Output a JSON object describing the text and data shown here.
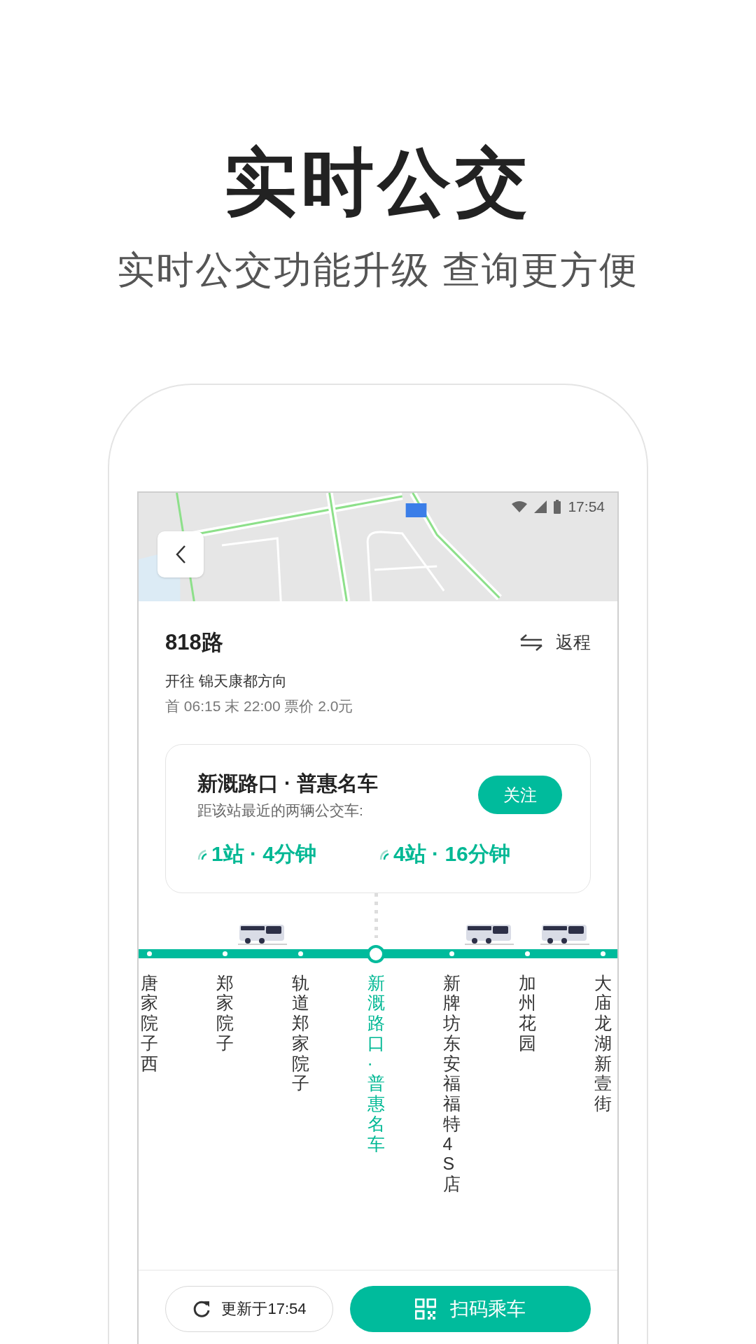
{
  "headline": "实时公交",
  "subheadline": "实时公交功能升级 查询更方便",
  "status_bar": {
    "time": "17:54"
  },
  "route": {
    "name": "818路",
    "return_label": "返程",
    "direction": "开往 锦天康都方向",
    "schedule": "首 06:15 末 22:00 票价 2.0元"
  },
  "stop_card": {
    "name": "新溉路口 · 普惠名车",
    "subtitle": "距该站最近的两辆公交车:",
    "follow_button": "关注",
    "arrivals": [
      {
        "text": "1站 · 4分钟"
      },
      {
        "text": "4站 · 16分钟"
      }
    ]
  },
  "stations": [
    {
      "name": "唐家院子西",
      "selected": false,
      "bus_after": false
    },
    {
      "name": "郑家院子",
      "selected": false,
      "bus_after": true
    },
    {
      "name": "轨道郑家院子",
      "selected": false,
      "bus_after": false
    },
    {
      "name": "新溉路口·普惠名车",
      "selected": true,
      "bus_after": false
    },
    {
      "name": "新牌坊东安福福特4S店",
      "selected": false,
      "bus_after": true
    },
    {
      "name": "加州花园",
      "selected": false,
      "bus_after": true
    },
    {
      "name": "大庙龙湖新壹街",
      "selected": false,
      "bus_after": false
    }
  ],
  "bottom_bar": {
    "refresh_label": "更新于17:54",
    "scan_button": "扫码乘车"
  }
}
